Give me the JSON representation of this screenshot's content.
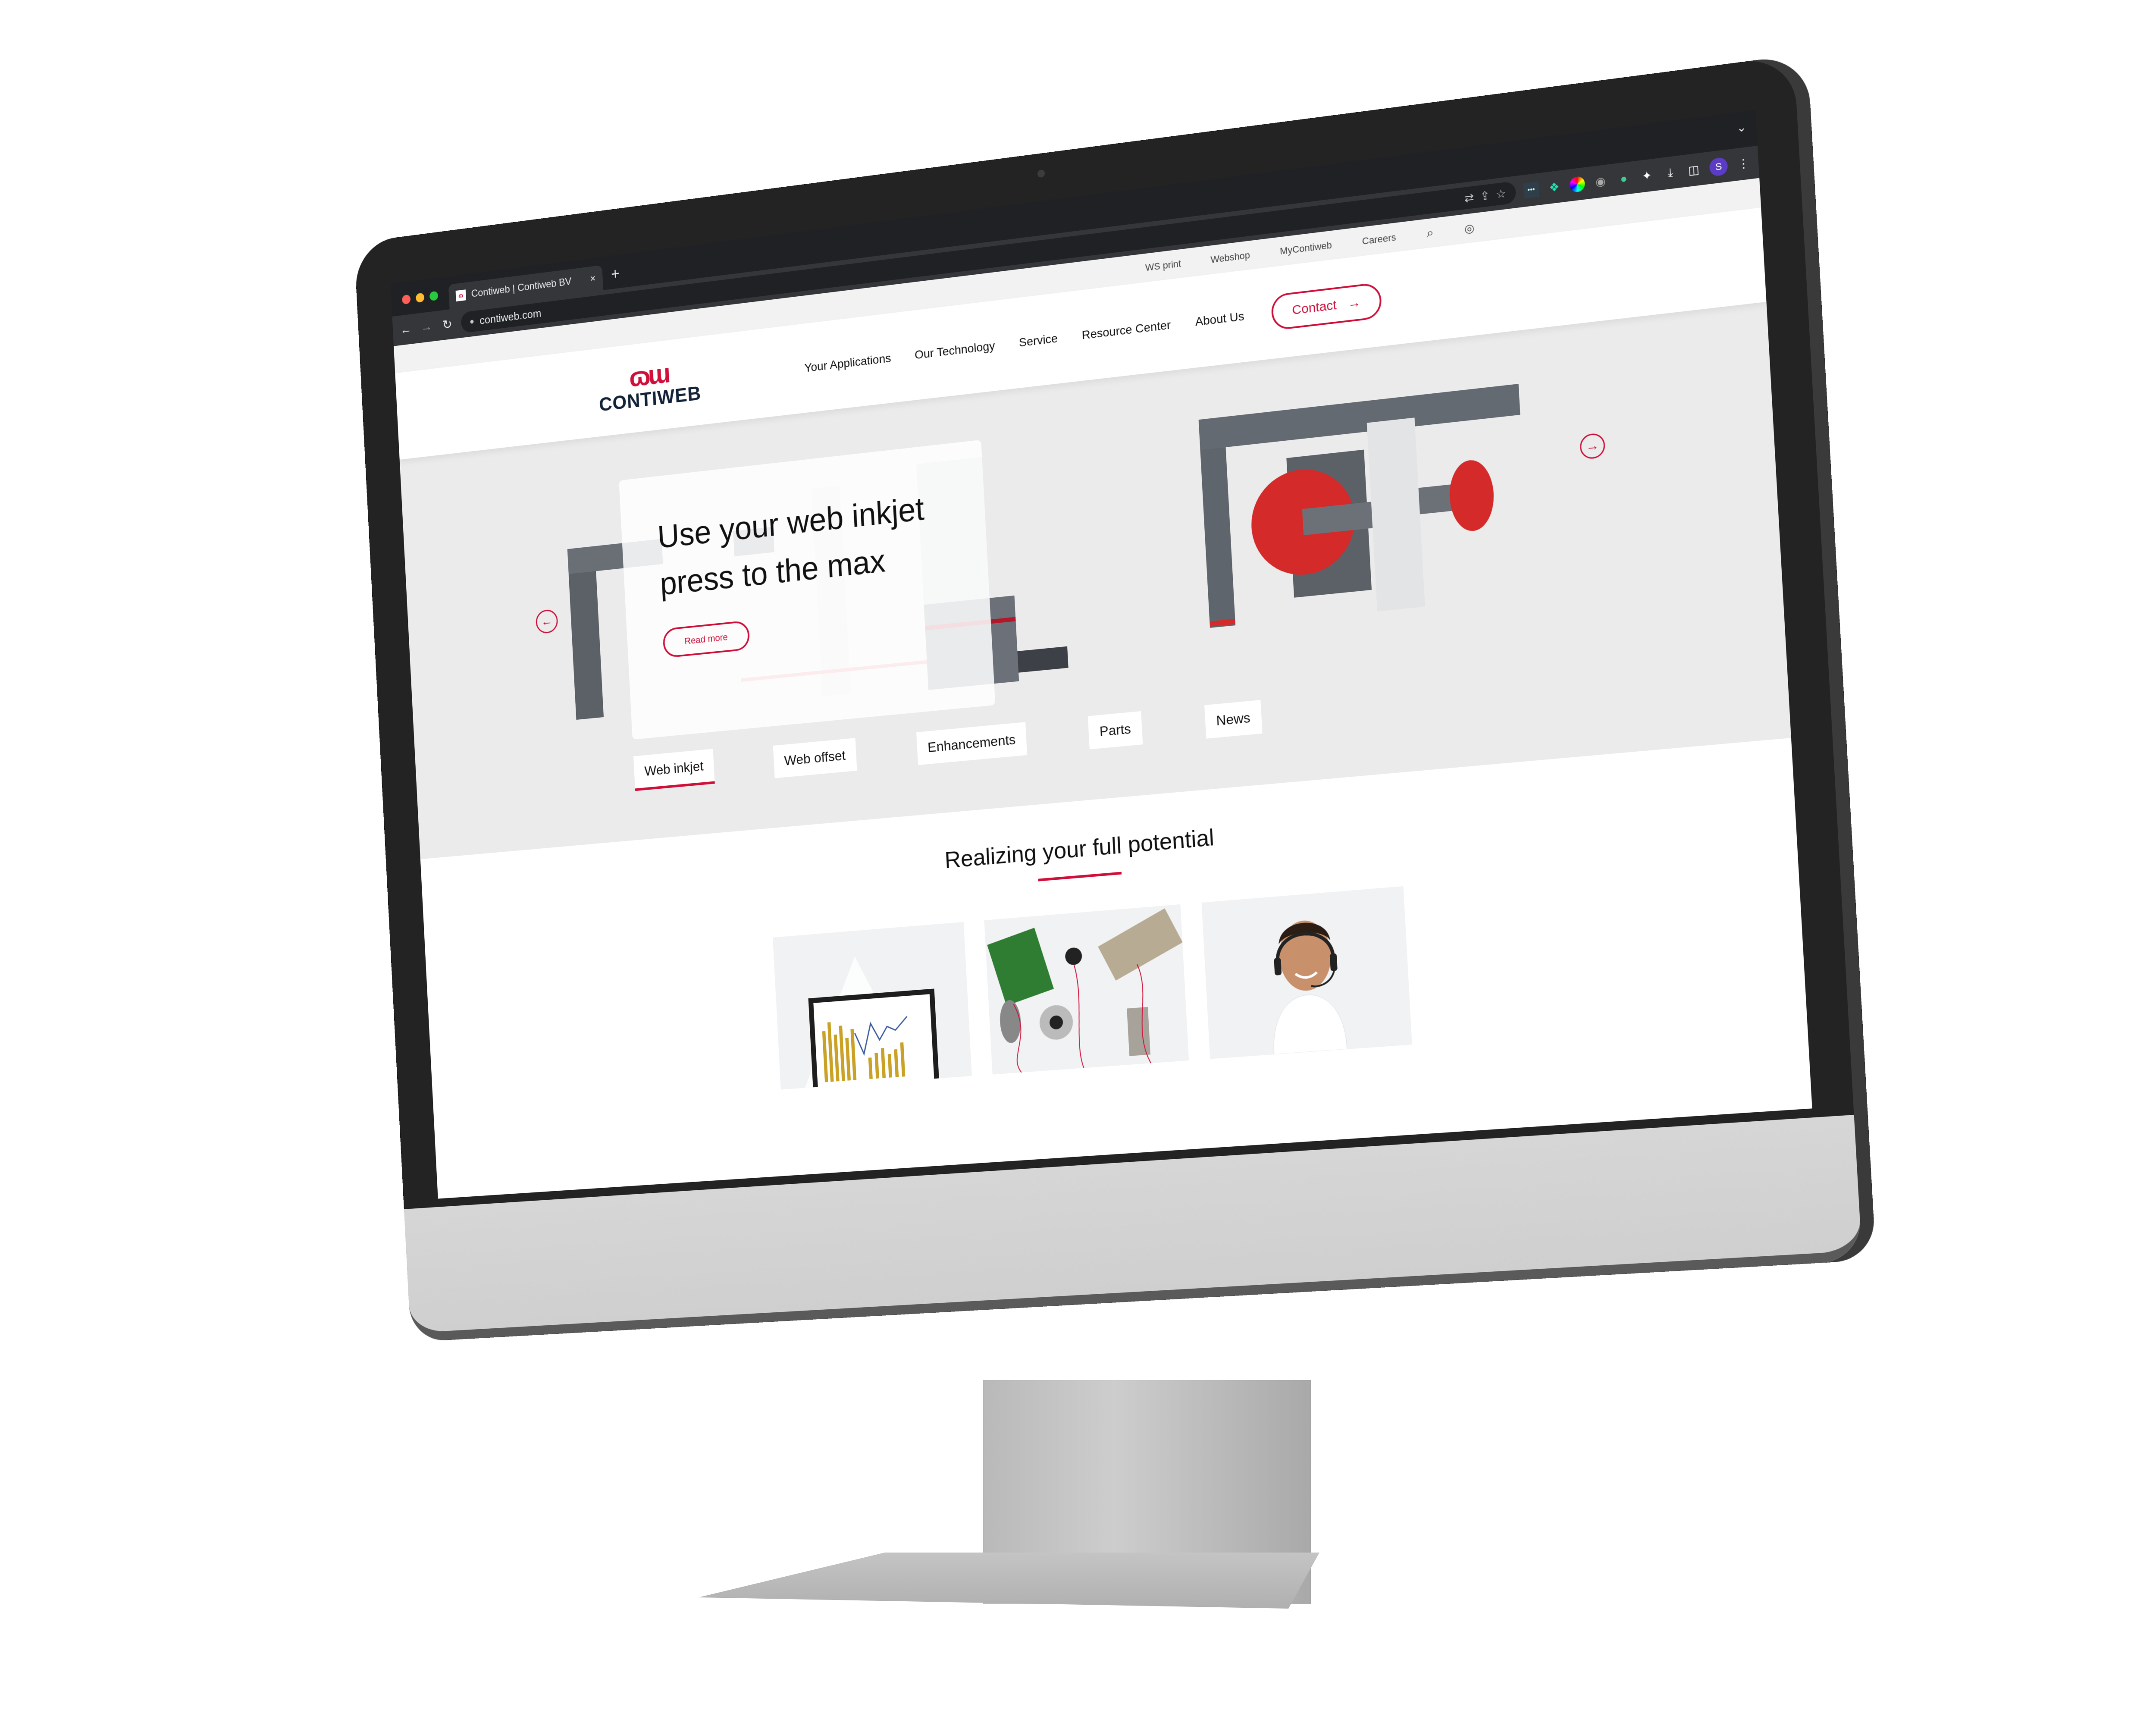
{
  "browser": {
    "traffic_lights": {
      "close": "#ff5f57",
      "minimize": "#febc2e",
      "maximize": "#28c840"
    },
    "tab": {
      "favicon": "contiweb-logo",
      "title": "Contiweb | Contiweb BV",
      "close_icon": "×"
    },
    "new_tab_icon": "+",
    "tab_strip_menu_icon": "⌄",
    "nav": {
      "back_icon": "←",
      "forward_icon": "→",
      "reload_icon": "↻"
    },
    "address": {
      "lock_icon": "🔒",
      "url": "contiweb.com",
      "translate_icon": "⇄",
      "share_icon": "⇪",
      "bookmark_icon": "☆"
    },
    "extensions": [
      "password-ext",
      "runner-ext",
      "color-picker-ext",
      "camera-ext",
      "bot-ext",
      "puzzle-icon",
      "download-icon",
      "side-panel-icon"
    ],
    "profile_initial": "S",
    "profile_color": "#5b3cc4",
    "menu_icon": "⋮"
  },
  "site": {
    "brand_color": "#d0103a",
    "utility_nav": [
      "WS print",
      "Webshop",
      "MyContiweb",
      "Careers"
    ],
    "utility_icons": {
      "search": "⌕",
      "language": "🌐"
    },
    "logo": {
      "mark": "ɷɯ",
      "wordmark": "CONTIWEB"
    },
    "main_nav": [
      "Your Applications",
      "Our Technology",
      "Service",
      "Resource Center",
      "About Us"
    ],
    "contact": {
      "label": "Contact",
      "icon": "→"
    },
    "hero": {
      "headline": "Use your web inkjet press to the max",
      "cta": "Read more",
      "prev_icon": "←",
      "next_icon": "→",
      "categories": [
        {
          "label": "Web inkjet",
          "active": true
        },
        {
          "label": "Web offset",
          "active": false
        },
        {
          "label": "Enhancements",
          "active": false
        },
        {
          "label": "Parts",
          "active": false
        },
        {
          "label": "News",
          "active": false
        }
      ]
    },
    "section": {
      "title": "Realizing your full potential",
      "tiles": [
        "analytics-dashboard-image",
        "parts-components-image",
        "service-agent-image"
      ]
    }
  }
}
